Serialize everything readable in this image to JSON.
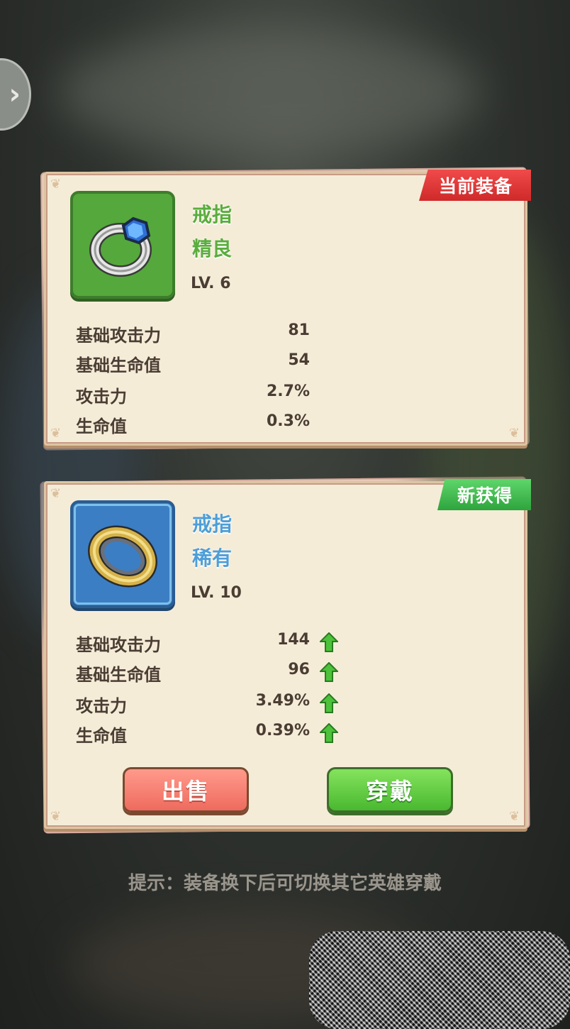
{
  "nav": {
    "side_arrow": "›"
  },
  "current": {
    "badge": "当前装备",
    "type": "戒指",
    "quality": "精良",
    "level": "LV. 6",
    "icon": "ring-blue-gem-icon",
    "stats": [
      {
        "label": "基础攻击力",
        "value": "81"
      },
      {
        "label": "基础生命值",
        "value": "54"
      },
      {
        "label": "攻击力",
        "value": "2.7%"
      },
      {
        "label": "生命值",
        "value": "0.3%"
      }
    ]
  },
  "new_item": {
    "badge": "新获得",
    "type": "戒指",
    "quality": "稀有",
    "level": "LV. 10",
    "icon": "ring-gold-band-icon",
    "stats": [
      {
        "label": "基础攻击力",
        "value": "144",
        "improved": true
      },
      {
        "label": "基础生命值",
        "value": "96",
        "improved": true
      },
      {
        "label": "攻击力",
        "value": "3.49%",
        "improved": true
      },
      {
        "label": "生命值",
        "value": "0.39%",
        "improved": true
      }
    ],
    "buttons": {
      "sell": "出售",
      "wear": "穿戴"
    }
  },
  "hint": "提示：装备换下后可切换其它英雄穿戴",
  "colors": {
    "badge_red": "#e03636",
    "badge_green": "#3fb84c",
    "rare_blue": "#4d9ed8",
    "good_green": "#5aad3d"
  }
}
